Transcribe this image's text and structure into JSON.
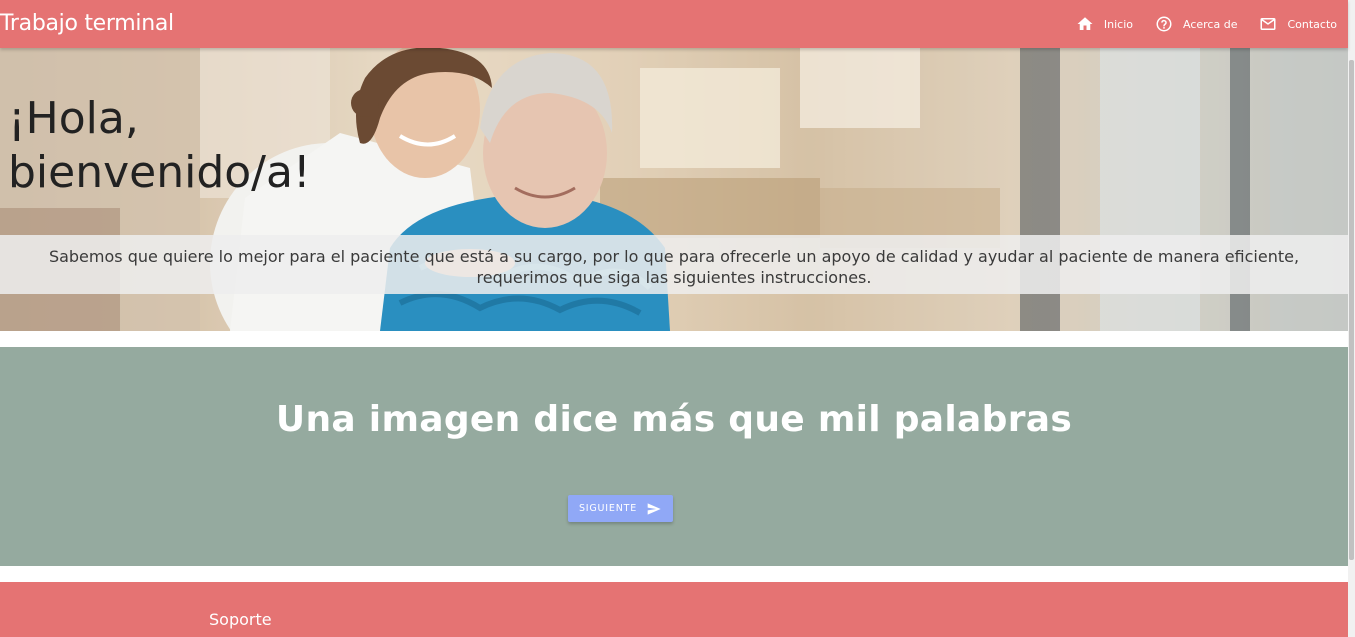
{
  "navbar": {
    "brand": "Trabajo terminal",
    "links": [
      {
        "label": "Inicio",
        "icon": "home-icon"
      },
      {
        "label": "Acerca de",
        "icon": "help-circle-icon"
      },
      {
        "label": "Contacto",
        "icon": "mail-icon"
      }
    ]
  },
  "hero": {
    "title": "¡Hola, bienvenido/a!",
    "text": "Sabemos que quiere lo mejor para el paciente que está a su cargo, por lo que para ofrecerle un apoyo de calidad y ayudar al paciente de manera eficiente, requerimos que siga las siguientes instrucciones."
  },
  "section": {
    "title": "Una imagen dice más que mil palabras",
    "button_label": "SIGUIENTE",
    "button_icon": "send-icon"
  },
  "footer": {
    "title": "Soporte"
  },
  "colors": {
    "navbar": "#e57373",
    "section": "#95aa9f",
    "button": "#90a8f6",
    "footer": "#e57373"
  }
}
